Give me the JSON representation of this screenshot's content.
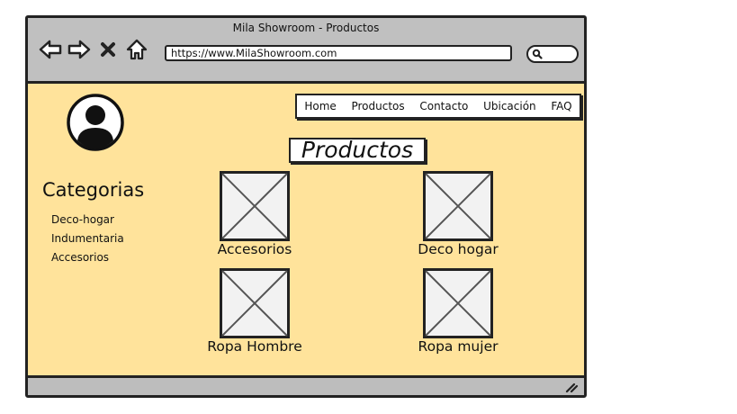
{
  "window": {
    "title": "Mila Showroom - Productos",
    "url": "https://www.MilaShowroom.com"
  },
  "nav": {
    "items": [
      {
        "label": "Home"
      },
      {
        "label": "Productos"
      },
      {
        "label": "Contacto"
      },
      {
        "label": "Ubicación"
      },
      {
        "label": "FAQ"
      }
    ]
  },
  "page": {
    "title": "Productos"
  },
  "sidebar": {
    "heading": "Categorias",
    "items": [
      {
        "label": "Deco-hogar"
      },
      {
        "label": "Indumentaria"
      },
      {
        "label": "Accesorios"
      }
    ]
  },
  "products": [
    {
      "label": "Accesorios"
    },
    {
      "label": "Deco hogar"
    },
    {
      "label": "Ropa Hombre"
    },
    {
      "label": "Ropa mujer"
    }
  ],
  "icons": {
    "back": "arrow-left-icon",
    "forward": "arrow-right-icon",
    "stop": "close-icon",
    "home": "home-icon",
    "search": "search-icon",
    "avatar": "user-avatar-icon",
    "resize": "resize-grip-icon"
  },
  "colors": {
    "content_bg": "#ffe39b",
    "chrome": "#c0c0c0",
    "stroke": "#222222"
  }
}
